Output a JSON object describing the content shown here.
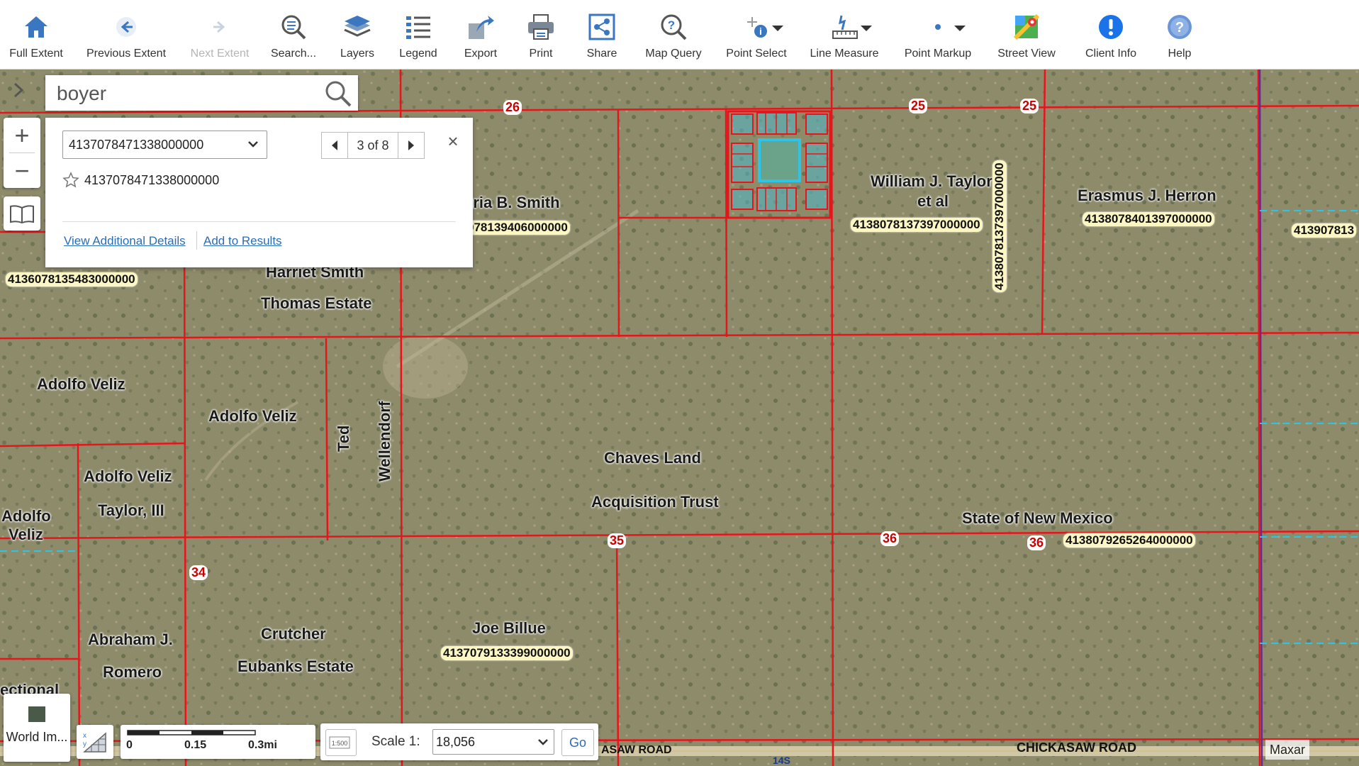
{
  "toolbar": {
    "tools": [
      {
        "label": "Full Extent",
        "icon": "home-icon"
      },
      {
        "label": "Previous Extent",
        "icon": "back-arrow-icon"
      },
      {
        "label": "Next Extent",
        "icon": "forward-arrow-icon"
      },
      {
        "label": "Search...",
        "icon": "search-list-icon"
      },
      {
        "label": "Layers",
        "icon": "layers-icon"
      },
      {
        "label": "Legend",
        "icon": "legend-icon"
      },
      {
        "label": "Export",
        "icon": "export-icon"
      },
      {
        "label": "Print",
        "icon": "printer-icon"
      },
      {
        "label": "Share",
        "icon": "share-icon"
      },
      {
        "label": "Map Query",
        "icon": "map-query-icon"
      },
      {
        "label": "Point Select",
        "icon": "point-select-icon"
      },
      {
        "label": "Line Measure",
        "icon": "ruler-icon"
      },
      {
        "label": "Point Markup",
        "icon": "point-markup-icon"
      },
      {
        "label": "Street View",
        "icon": "street-view-icon"
      },
      {
        "label": "Client Info",
        "icon": "info-icon"
      },
      {
        "label": "Help",
        "icon": "help-icon"
      }
    ]
  },
  "search": {
    "value": "boyer"
  },
  "popup": {
    "selected_parcel": "4137078471338000000",
    "pager": "3 of 8",
    "title": "4137078471338000000",
    "close": "×",
    "link_details": "View Additional Details",
    "link_results": "Add to Results"
  },
  "zoom": {
    "in": "+",
    "out": "−"
  },
  "map": {
    "owners": [
      "tria B. Smith",
      "Harriet Smith",
      "Thomas Estate",
      "William J. Taylor",
      "et al",
      "Erasmus J. Herron",
      "Adolfo Veliz",
      "Adolfo Veliz",
      "Adolfo Veliz",
      "Taylor, III",
      "Adolfo",
      "Veliz",
      "Ted",
      "Wellendorf",
      "Chaves Land",
      "Acquisition Trust",
      "State of New Mexico",
      "Joe Billue",
      "Abraham J.",
      "Romero",
      "Crutcher",
      "Eubanks Estate",
      "ectional"
    ],
    "parcel_ids": [
      "4136078135483000000",
      "078139406000000",
      "4138078137397000000",
      "4138078401397000000",
      "413907813",
      "4138079265264000000",
      "4137079133399000000",
      "4138078137397000000"
    ],
    "sections": [
      "26",
      "25",
      "25",
      "35",
      "36",
      "36",
      "34"
    ],
    "roads": [
      "CHICKASAW ROAD",
      "ASAW ROAD",
      "14S"
    ],
    "colors": {
      "parcel_line": "#e8141b",
      "selected": "#2ec4e8",
      "terrain": "#8d8a6a"
    }
  },
  "basemap": {
    "label": "World Im..."
  },
  "scalebar": {
    "t0": "0",
    "t1": "0.15",
    "t2": "0.3mi"
  },
  "scale": {
    "label": "Scale 1:",
    "value": "18,056",
    "go": "Go",
    "icon_text": "1:500"
  },
  "attribution": "Maxar"
}
